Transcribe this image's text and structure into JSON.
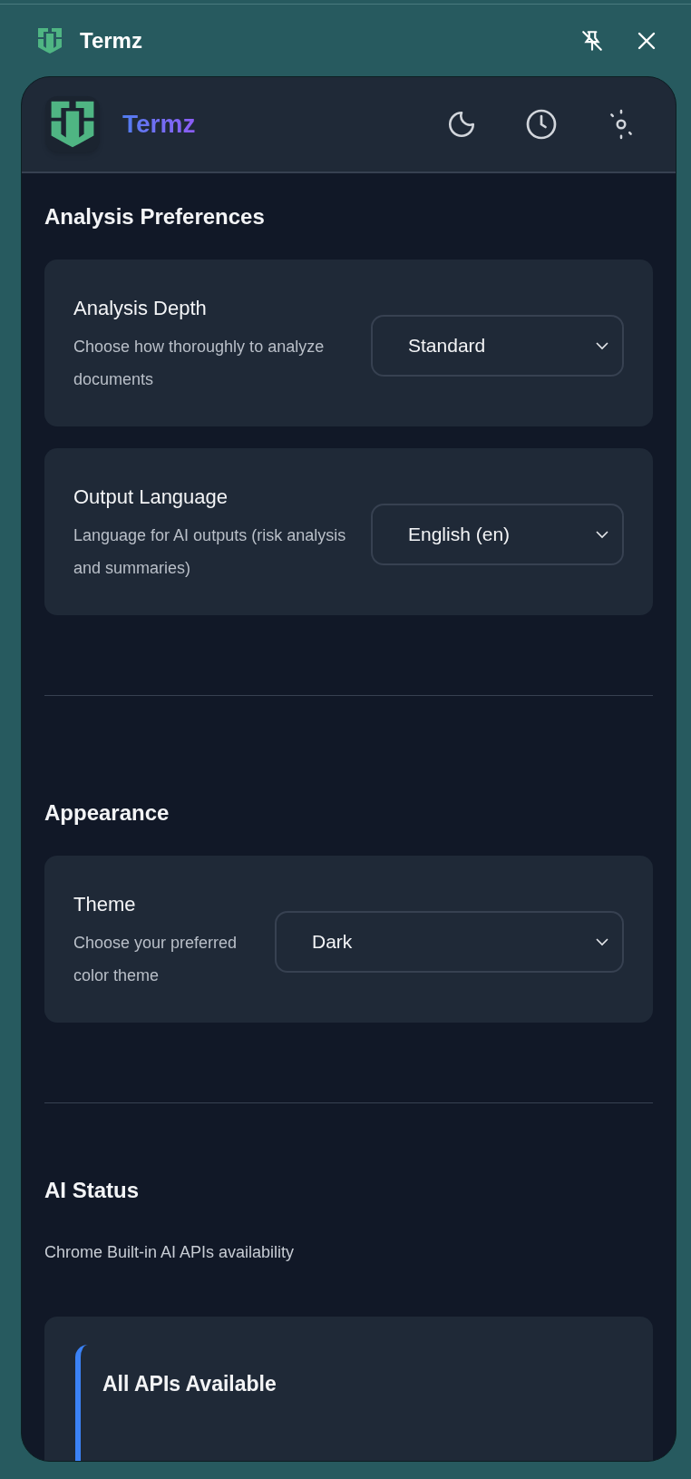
{
  "window": {
    "title": "Termz"
  },
  "header": {
    "app_name": "Termz"
  },
  "sections": [
    {
      "heading": "Analysis Preferences",
      "settings": [
        {
          "label": "Analysis Depth",
          "description": "Choose how thoroughly to analyze documents",
          "value": "Standard"
        },
        {
          "label": "Output Language",
          "description": "Language for AI outputs (risk analysis and summaries)",
          "value": "English (en)"
        }
      ]
    },
    {
      "heading": "Appearance",
      "settings": [
        {
          "label": "Theme",
          "description": "Choose your preferred color theme",
          "value": "Dark"
        }
      ]
    },
    {
      "heading": "AI Status",
      "subtitle": "Chrome Built-in AI APIs availability",
      "status_card": {
        "title": "All APIs Available"
      }
    }
  ]
}
